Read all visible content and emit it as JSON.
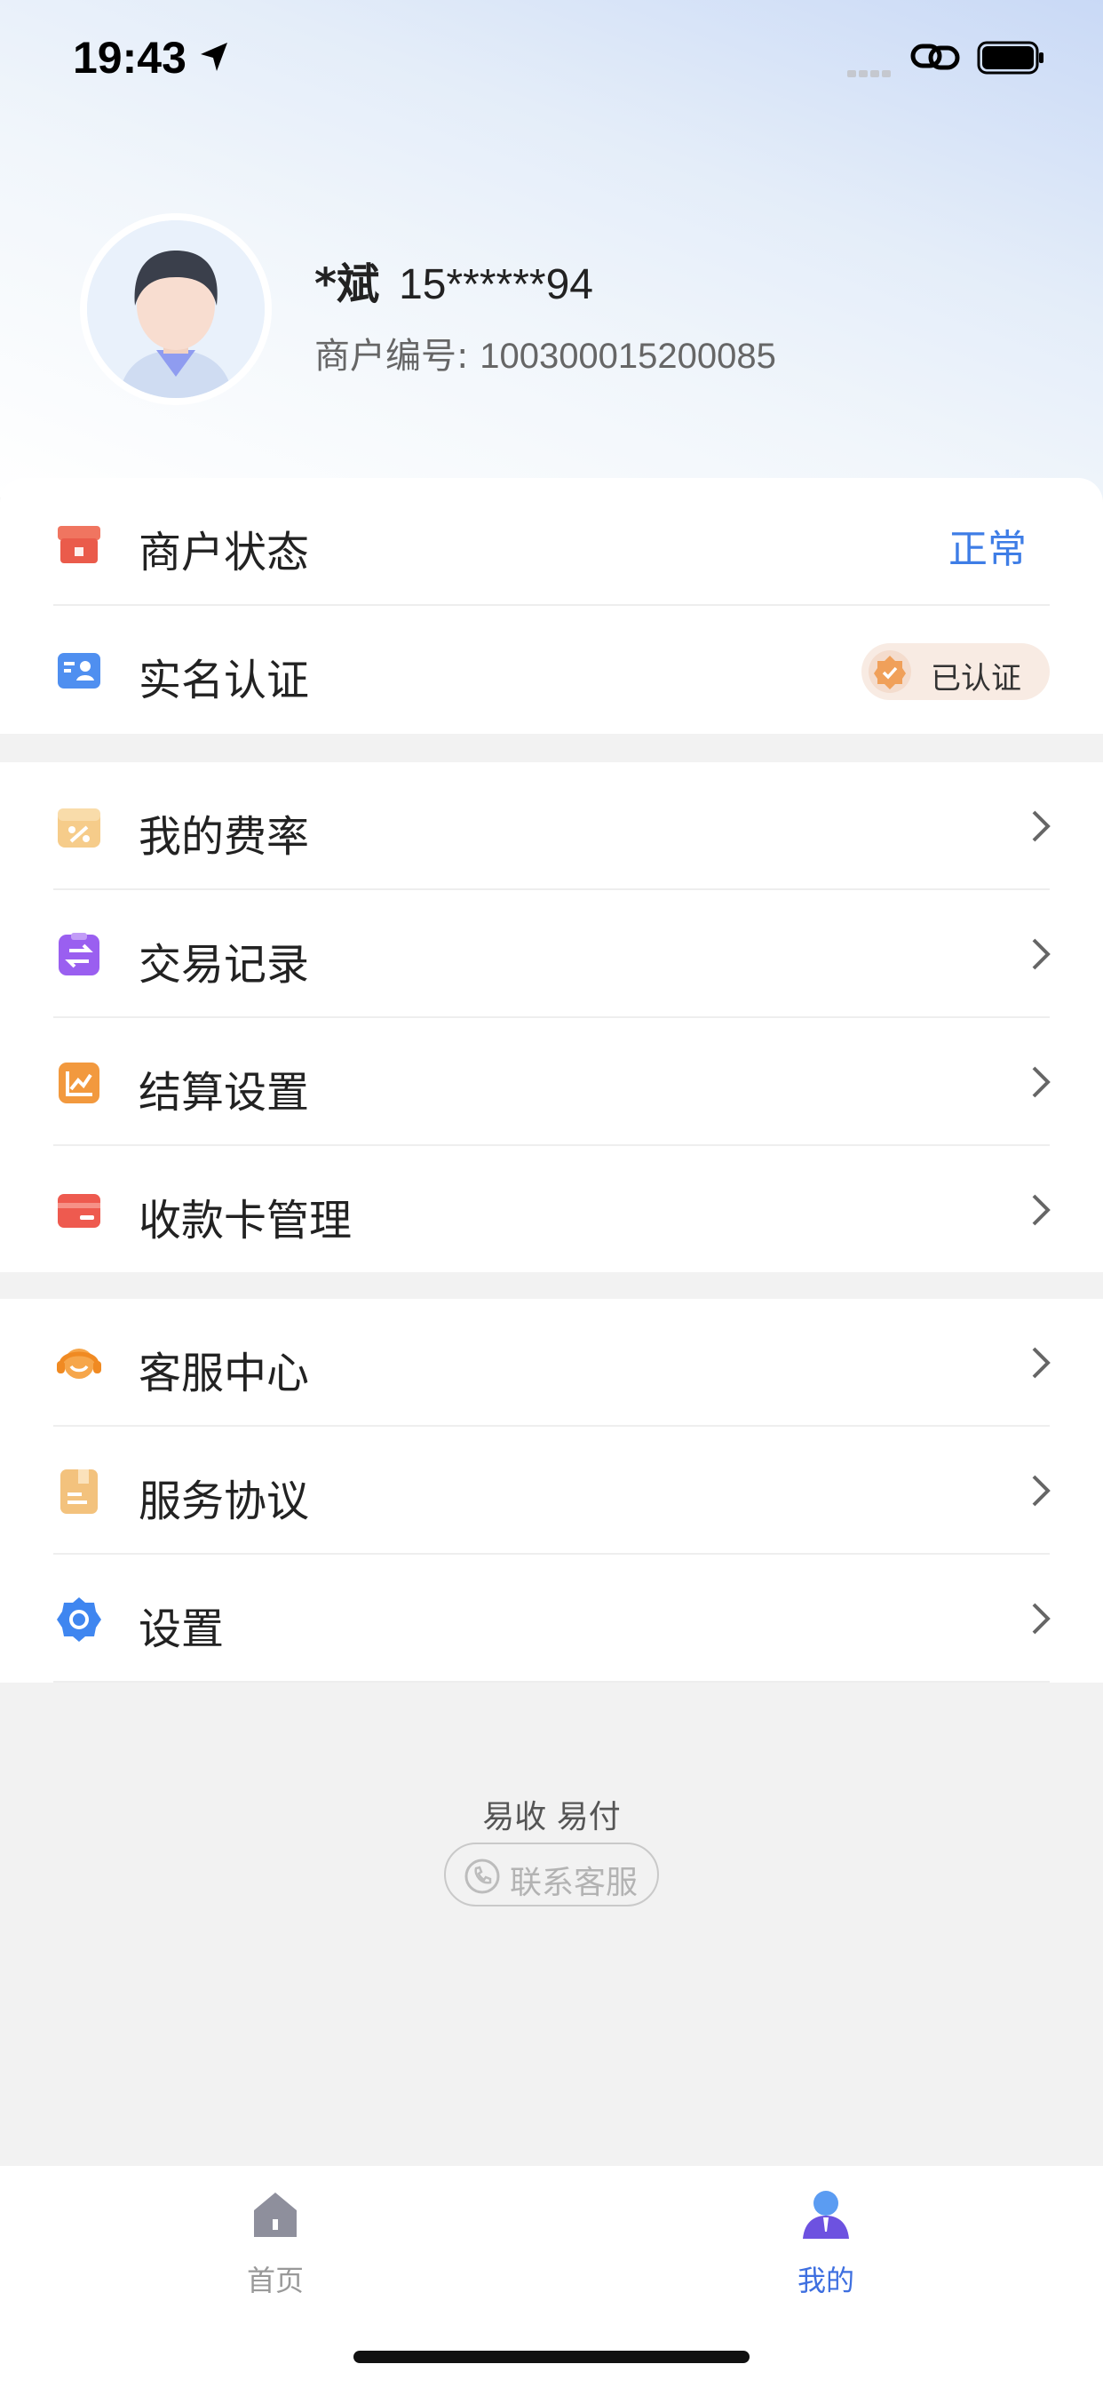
{
  "status_bar": {
    "time": "19:43"
  },
  "profile": {
    "name": "*斌",
    "phone": "15******94",
    "merchant_label": "商户编号:",
    "merchant_no": "100300015200085"
  },
  "account_section": {
    "merchant_status": {
      "label": "商户状态",
      "value": "正常",
      "value_color": "#3e7de6",
      "icon": "store-icon"
    },
    "real_name": {
      "label": "实名认证",
      "badge": "已认证",
      "icon": "id-card-icon"
    }
  },
  "business_section": {
    "items": [
      {
        "label": "我的费率",
        "icon": "rate-percent-icon"
      },
      {
        "label": "交易记录",
        "icon": "transaction-record-icon"
      },
      {
        "label": "结算设置",
        "icon": "settlement-chart-icon"
      },
      {
        "label": "收款卡管理",
        "icon": "bank-card-icon"
      }
    ]
  },
  "service_section": {
    "items": [
      {
        "label": "客服中心",
        "icon": "headset-icon"
      },
      {
        "label": "服务协议",
        "icon": "agreement-document-icon"
      },
      {
        "label": "设置",
        "icon": "gear-icon"
      }
    ]
  },
  "footer": {
    "brand": "易收 易付",
    "contact_label": "联系客服"
  },
  "tabbar": {
    "home_label": "首页",
    "mine_label": "我的",
    "active": "我的",
    "active_color": "#3e6fe0"
  }
}
